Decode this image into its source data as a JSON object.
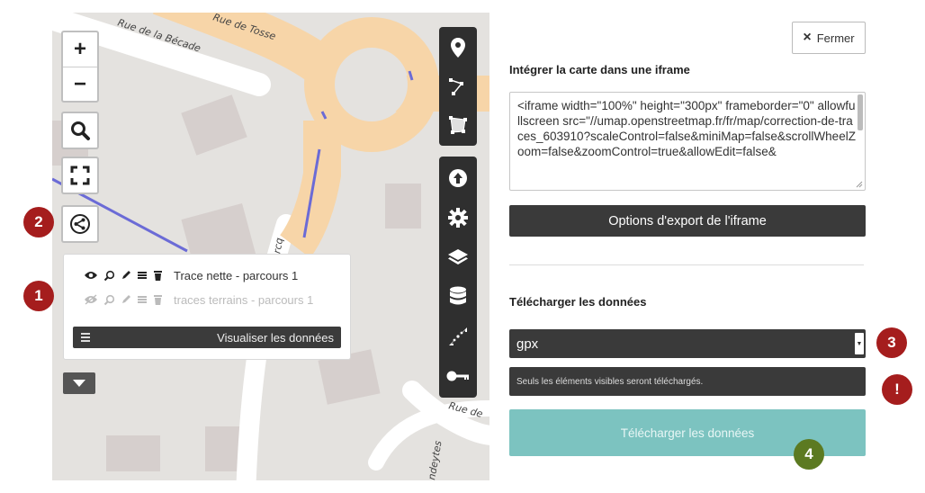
{
  "map": {
    "street_labels": [
      "Rue de la Bécade",
      "Rue de Tosse",
      "Rue de",
      "ercq",
      "ndeytes"
    ],
    "controls": {
      "zoom_in": "+",
      "zoom_out": "−",
      "search_icon": "search-icon",
      "fullscreen_icon": "fullscreen-icon",
      "share_icon": "share-icon"
    },
    "layers": [
      {
        "name": "Trace nette - parcours 1",
        "visible": true
      },
      {
        "name": "traces terrains - parcours 1",
        "visible": false
      }
    ],
    "visualize_data_label": "Visualiser les données",
    "edit_toolbar_top": [
      "marker-icon",
      "polyline-icon",
      "polygon-icon"
    ],
    "edit_toolbar_bottom": [
      "upload-icon",
      "gear-icon",
      "layers-icon",
      "database-icon",
      "arrows-icon",
      "key-icon"
    ]
  },
  "panel": {
    "close_label": "Fermer",
    "embed_title": "Intégrer la carte dans une iframe",
    "iframe_code": "<iframe width=\"100%\" height=\"300px\" frameborder=\"0\" allowfullscreen src=\"//umap.openstreetmap.fr/fr/map/correction-de-traces_603910?scaleControl=false&miniMap=false&scrollWheelZoom=false&zoomControl=true&allowEdit=false&",
    "export_options_label": "Options d'export de l'iframe",
    "download_title": "Télécharger les données",
    "format_selected": "gpx",
    "help_text": "Seuls les éléments visibles seront téléchargés.",
    "download_button_label": "Télécharger les données"
  },
  "badges": {
    "b1": "1",
    "b2": "2",
    "b3": "3",
    "b_warn": "!",
    "b4": "4"
  },
  "colors": {
    "badge_red": "#a51d1d",
    "badge_green": "#5c7a21",
    "download_button": "#7cc3c0",
    "dark_controls": "#3a3a3a",
    "road_main": "#f7d5a8",
    "map_background": "#e4e2df",
    "trace_line": "#6b6bd6"
  }
}
